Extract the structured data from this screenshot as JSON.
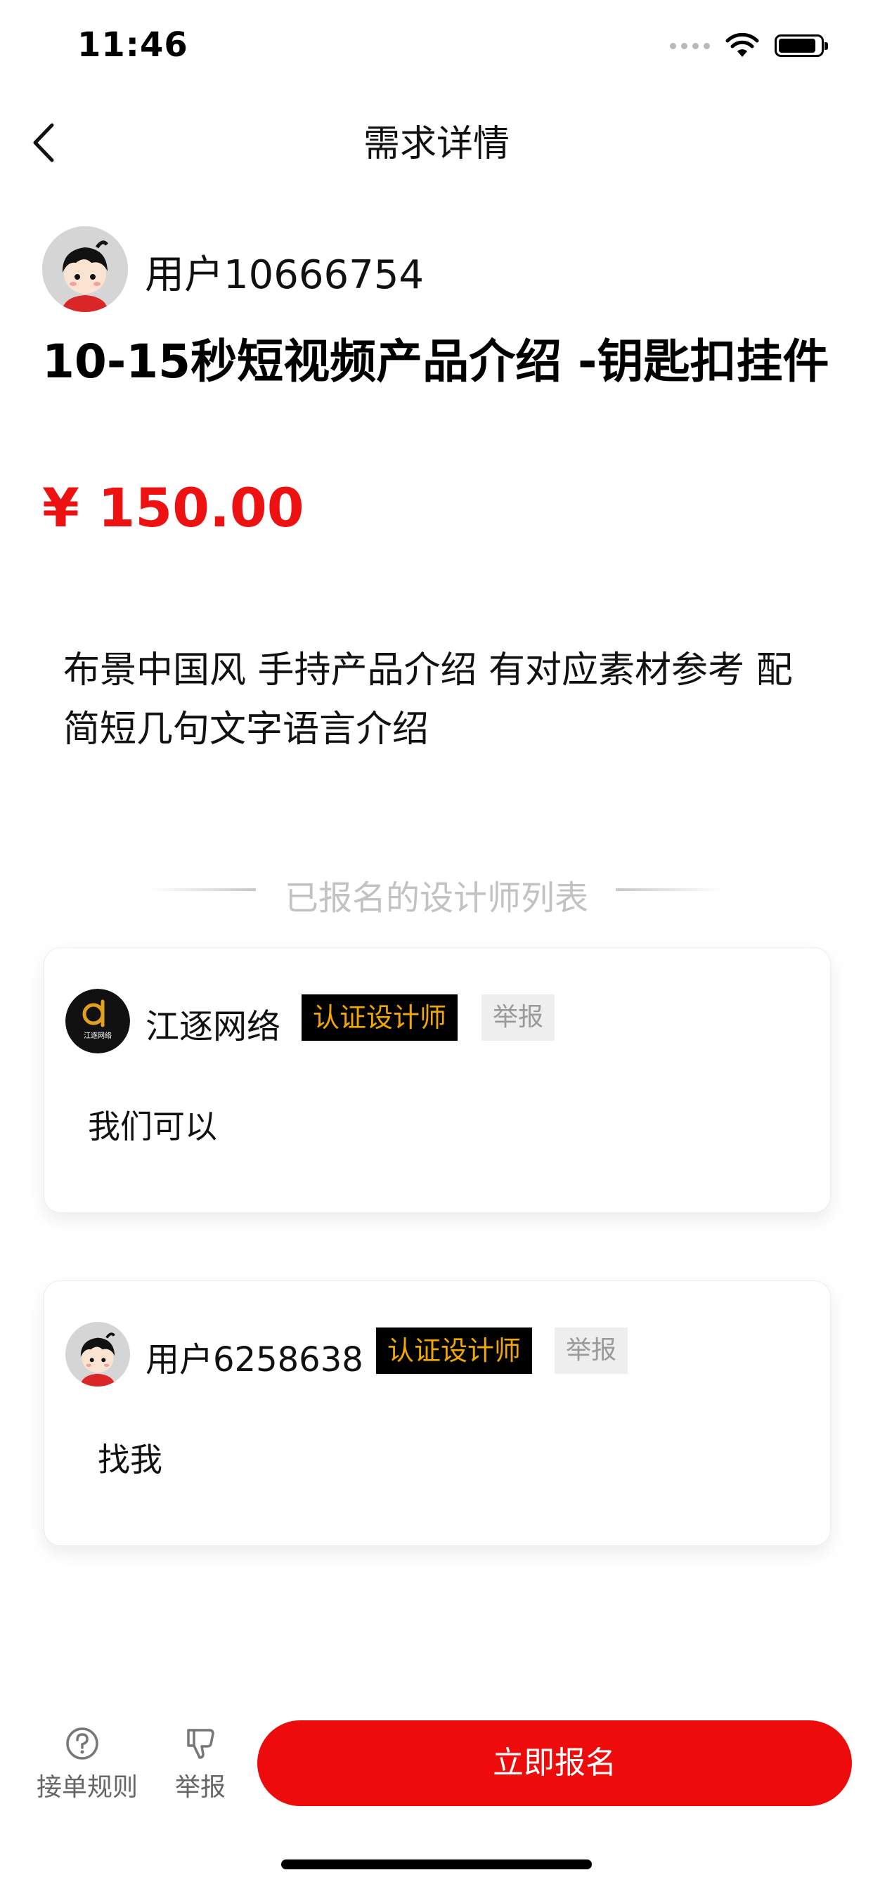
{
  "status_bar": {
    "time": "11:46",
    "battery_level": 0.9
  },
  "nav": {
    "title": "需求详情"
  },
  "poster": {
    "name": "用户10666754"
  },
  "post": {
    "title": "10-15秒短视频产品介绍 -钥匙扣挂件",
    "price": "¥ 150.00",
    "description": "布景中国风 手持产品介绍 有对应素材参考 配简短几句文字语言介绍"
  },
  "applicants_section": {
    "title": "已报名的设计师列表"
  },
  "applicants": [
    {
      "name": "江逐网络",
      "logo_text": "江逐网络",
      "badge": "认证设计师",
      "report": "举报",
      "message": "我们可以"
    },
    {
      "name": "用户6258638",
      "badge": "认证设计师",
      "report": "举报",
      "message": "找我"
    }
  ],
  "bottom_bar": {
    "rules_label": "接单规则",
    "report_label": "举报",
    "cta_label": "立即报名"
  },
  "colors": {
    "accent_red": "#ee0b0b",
    "price_red": "#ee1111",
    "badge_gold": "#f0a800"
  }
}
